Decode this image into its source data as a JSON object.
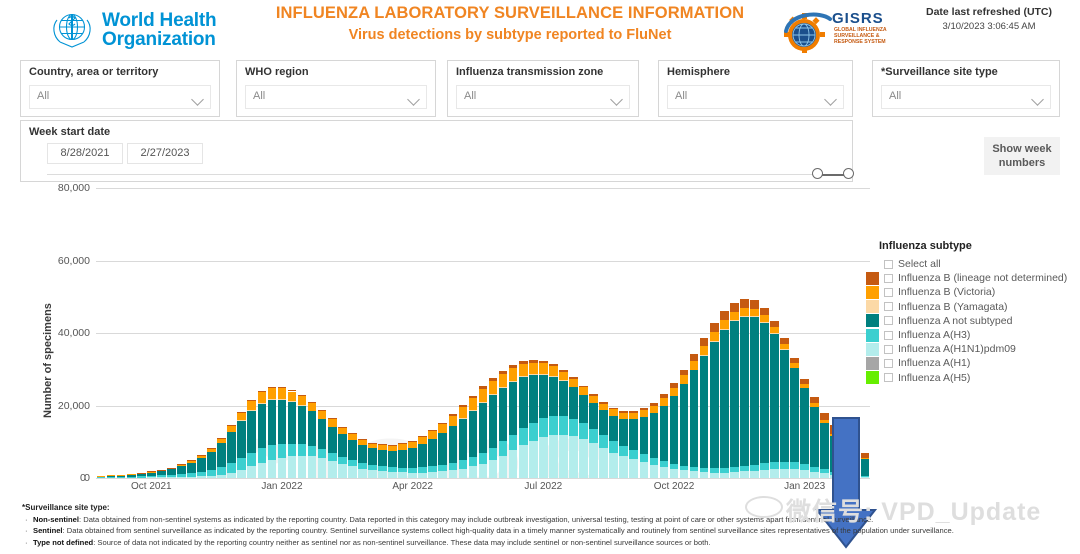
{
  "header": {
    "org_line1": "World Health",
    "org_line2": "Organization",
    "title_main": "INFLUENZA LABORATORY SURVEILLANCE INFORMATION",
    "title_sub": "Virus detections by subtype reported to FluNet",
    "gisrs_acronym": "GISRS",
    "gisrs_line1": "GLOBAL INFLUENZA",
    "gisrs_line2": "SURVEILLANCE &",
    "gisrs_line3": "RESPONSE SYSTEM",
    "refresh_label": "Date last refreshed (UTC)",
    "refresh_value": "3/10/2023 3:06:45 AM",
    "accent_orange": "#F08522",
    "who_blue": "#0093D5"
  },
  "slicers": [
    {
      "title": "Country, area or territory",
      "value": "All"
    },
    {
      "title": "WHO region",
      "value": "All"
    },
    {
      "title": "Influenza transmission zone",
      "value": "All"
    },
    {
      "title": "Hemisphere",
      "value": "All"
    },
    {
      "title": "*Surveillance site type",
      "value": "All"
    }
  ],
  "date_slicer": {
    "title": "Week start date",
    "from": "8/28/2021",
    "to": "2/27/2023"
  },
  "week_numbers_button": "Show week numbers",
  "legend": {
    "title": "Influenza subtype",
    "select_all": "Select all",
    "items": [
      {
        "label": "Influenza B (lineage not determined)",
        "color": "#C55A11"
      },
      {
        "label": "Influenza B (Victoria)",
        "color": "#FFA000"
      },
      {
        "label": "Influenza B (Yamagata)",
        "color": "#FCD9A6"
      },
      {
        "label": "Influenza A not subtyped",
        "color": "#00807F"
      },
      {
        "label": "Influenza A(H3)",
        "color": "#3BCFCF"
      },
      {
        "label": "Influenza A(H1N1)pdm09",
        "color": "#B3EDEC"
      },
      {
        "label": "Influenza A(H1)",
        "color": "#A6A6A6"
      },
      {
        "label": "Influenza A(H5)",
        "color": "#66EE00"
      }
    ]
  },
  "watermark": "GISRS",
  "annotation": {
    "type": "down-arrow",
    "color": "#4472C4",
    "outline": "#2F528F"
  },
  "footnotes": {
    "heading": "*Surveillance site type:",
    "rows": [
      {
        "term": "Non-sentinel",
        "text": ": Data obtained from non-sentinel systems as indicated by the reporting country. Data reported in this category may include outbreak investigation, universal testing, testing at point of care or other systems apart from sentinel surveillance."
      },
      {
        "term": "Sentinel",
        "text": ": Data obtained from sentinel surveillance as indicated by the reporting country. Sentinel surveillance systems collect high-quality data in a timely manner systematically and routinely from sentinel surveillance sites representatives of the population under surveillance."
      },
      {
        "term": "Type not defined",
        "text": ": Source of data not indicated by the reporting country neither as sentinel nor as non-sentinel surveillance. These data may include sentinel or non-sentinel surveillance sources or both."
      }
    ]
  },
  "overlay_text": "微信号: VPD_Update",
  "chart_data": {
    "type": "bar",
    "stacked": true,
    "title": "",
    "xlabel": "",
    "ylabel": "Number of specimens",
    "ylim": [
      0,
      80000
    ],
    "yticks": [
      0,
      20000,
      40000,
      60000,
      80000
    ],
    "ytick_labels": [
      "0",
      "20,000",
      "40,000",
      "60,000",
      "80,000"
    ],
    "grid": true,
    "legend_position": "right",
    "xtick_labels": [
      "Oct 2021",
      "Jan 2022",
      "Apr 2022",
      "Jul 2022",
      "Oct 2022",
      "Jan 2023"
    ],
    "xtick_index": [
      5,
      18,
      31,
      44,
      57,
      70
    ],
    "x_start": "2021-08-28",
    "x_end": "2023-02-27",
    "series": [
      {
        "name": "Influenza A(H1N1)pdm09",
        "color": "#B3EDEC",
        "values": [
          60,
          80,
          90,
          110,
          140,
          160,
          190,
          230,
          300,
          380,
          480,
          620,
          900,
          1400,
          2200,
          3200,
          4200,
          5000,
          5600,
          6000,
          6200,
          6000,
          5400,
          4600,
          3800,
          3200,
          2600,
          2200,
          1900,
          1700,
          1600,
          1500,
          1500,
          1600,
          1800,
          2100,
          2600,
          3200,
          4000,
          5000,
          6200,
          7600,
          9000,
          10200,
          11200,
          11800,
          12000,
          11600,
          10800,
          9600,
          8200,
          7000,
          6000,
          5200,
          4400,
          3600,
          3000,
          2500,
          2100,
          1800,
          1600,
          1500,
          1500,
          1600,
          1800,
          2000,
          2200,
          2400,
          2500,
          2400,
          2100,
          1700,
          1300,
          900,
          600,
          400,
          300
        ]
      },
      {
        "name": "Influenza A(H3)",
        "color": "#3BCFCF",
        "values": [
          120,
          160,
          200,
          260,
          330,
          420,
          520,
          640,
          820,
          1000,
          1300,
          1700,
          2200,
          2800,
          3400,
          3800,
          4000,
          4000,
          3800,
          3500,
          3200,
          2900,
          2600,
          2300,
          2000,
          1800,
          1600,
          1450,
          1350,
          1300,
          1300,
          1350,
          1450,
          1600,
          1800,
          2000,
          2300,
          2600,
          3000,
          3400,
          3900,
          4400,
          4800,
          5100,
          5300,
          5300,
          5100,
          4800,
          4400,
          4000,
          3600,
          3200,
          2800,
          2500,
          2200,
          1900,
          1700,
          1500,
          1350,
          1250,
          1200,
          1200,
          1250,
          1350,
          1500,
          1700,
          1900,
          2000,
          2000,
          1900,
          1700,
          1400,
          1100,
          800,
          600,
          450,
          350
        ]
      },
      {
        "name": "Influenza A not subtyped",
        "color": "#00807F",
        "values": [
          350,
          420,
          500,
          620,
          780,
          980,
          1250,
          1600,
          2100,
          2800,
          3700,
          4900,
          6500,
          8400,
          10300,
          11800,
          12600,
          12800,
          12400,
          11600,
          10600,
          9500,
          8400,
          7300,
          6300,
          5500,
          4900,
          4500,
          4400,
          4500,
          4900,
          5500,
          6400,
          7500,
          8800,
          10200,
          11600,
          12900,
          14000,
          14700,
          15000,
          14800,
          14200,
          13300,
          12200,
          11000,
          9800,
          8700,
          7800,
          7200,
          6900,
          7000,
          7500,
          8600,
          10200,
          12400,
          15200,
          18600,
          22500,
          26800,
          31200,
          35200,
          38400,
          40600,
          41500,
          41000,
          39000,
          35500,
          31000,
          26000,
          21000,
          16500,
          12800,
          9800,
          7500,
          5800,
          4500
        ]
      },
      {
        "name": "Influenza B (Yamagata)",
        "color": "#FCD9A6",
        "values": [
          5,
          5,
          6,
          6,
          8,
          8,
          10,
          10,
          12,
          12,
          15,
          15,
          18,
          20,
          22,
          25,
          25,
          25,
          22,
          20,
          18,
          16,
          14,
          12,
          10,
          10,
          10,
          10,
          10,
          10,
          12,
          12,
          15,
          15,
          18,
          20,
          22,
          25,
          28,
          30,
          32,
          32,
          30,
          28,
          26,
          24,
          22,
          20,
          18,
          16,
          15,
          14,
          13,
          12,
          12,
          12,
          14,
          16,
          18,
          20,
          22,
          25,
          28,
          30,
          30,
          28,
          26,
          24,
          22,
          20,
          18,
          16,
          14,
          12,
          10,
          8,
          6
        ]
      },
      {
        "name": "Influenza B (Victoria)",
        "color": "#FFA000",
        "values": [
          60,
          80,
          100,
          130,
          170,
          220,
          280,
          360,
          470,
          600,
          780,
          1000,
          1300,
          1700,
          2100,
          2500,
          2800,
          2950,
          2900,
          2750,
          2550,
          2350,
          2150,
          1950,
          1750,
          1600,
          1500,
          1450,
          1450,
          1500,
          1600,
          1750,
          1950,
          2200,
          2500,
          2800,
          3100,
          3400,
          3600,
          3700,
          3700,
          3600,
          3400,
          3150,
          2900,
          2650,
          2400,
          2200,
          2000,
          1850,
          1750,
          1700,
          1700,
          1750,
          1850,
          2000,
          2150,
          2300,
          2400,
          2450,
          2450,
          2400,
          2300,
          2200,
          2050,
          1900,
          1750,
          1600,
          1450,
          1300,
          1150,
          1000,
          850,
          700,
          550,
          420,
          320
        ]
      },
      {
        "name": "Influenza B (lineage not determined)",
        "color": "#C55A11",
        "values": [
          10,
          12,
          15,
          18,
          22,
          28,
          35,
          45,
          58,
          75,
          95,
          120,
          150,
          190,
          240,
          290,
          330,
          360,
          370,
          370,
          350,
          330,
          300,
          270,
          240,
          210,
          190,
          180,
          180,
          190,
          210,
          240,
          280,
          330,
          390,
          450,
          520,
          590,
          650,
          700,
          730,
          740,
          730,
          700,
          660,
          610,
          560,
          510,
          470,
          440,
          420,
          420,
          440,
          500,
          600,
          760,
          980,
          1250,
          1550,
          1850,
          2150,
          2350,
          2500,
          2550,
          2500,
          2350,
          2150,
          1900,
          1700,
          1500,
          1450,
          1600,
          2000,
          2500,
          3000,
          3200,
          1400
        ]
      },
      {
        "name": "Influenza A(H1)",
        "color": "#A6A6A6",
        "values": []
      },
      {
        "name": "Influenza A(H5)",
        "color": "#66EE00",
        "values": []
      }
    ]
  }
}
